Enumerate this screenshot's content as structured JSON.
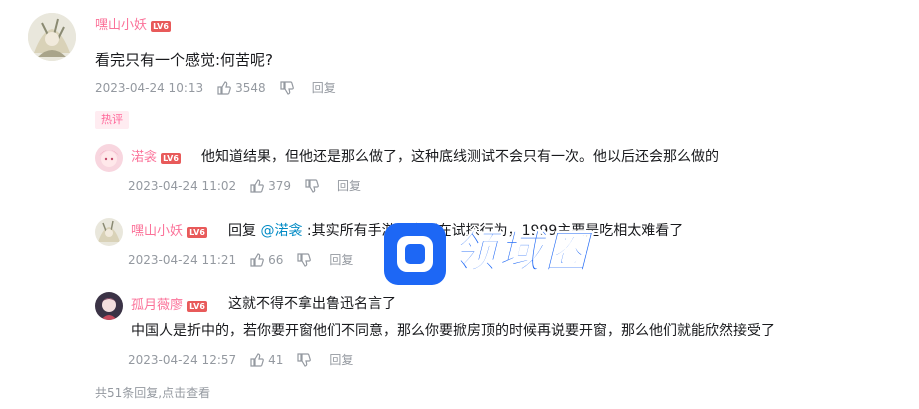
{
  "main_comment": {
    "username": "嘿山小妖",
    "level": "LV6",
    "text": "看完只有一个感觉:何苦呢?",
    "time": "2023-04-24 10:13",
    "likes": "3548",
    "reply_label": "回复",
    "badge": "热评"
  },
  "replies": [
    {
      "username": "渃衾",
      "level": "LV6",
      "text": "他知道结果，但他还是那么做了，这种底线测试不会只有一次。他以后还会那么做的",
      "time": "2023-04-24 11:02",
      "likes": "379",
      "reply_label": "回复"
    },
    {
      "username": "嘿山小妖",
      "level": "LV6",
      "prefix": "回复",
      "mention": "@渃衾",
      "text": ":其实所有手游厂商都在试探行为，1999主要是吃相太难看了",
      "time": "2023-04-24 11:21",
      "likes": "66",
      "reply_label": "回复"
    },
    {
      "username": "孤月薇廖",
      "level": "LV6",
      "text_line1": "这就不得不拿出鲁迅名言了",
      "text_line2": "中国人是折中的，若你要开窗他们不同意，那么你要掀房顶的时候再说要开窗，那么他们就能欣然接受了",
      "time": "2023-04-24 12:57",
      "likes": "41",
      "reply_label": "回复"
    }
  ],
  "footer": {
    "count_text": "共51条回复,",
    "view_text": "点击查看"
  },
  "watermark": {
    "text": "领域圈"
  },
  "colors": {
    "username": "#fb7299",
    "mention": "#008ac5",
    "meta": "#9499a0",
    "level_badge": "#e85a5a",
    "hot_badge_bg": "#ffecf1",
    "watermark": "#1d67f5"
  }
}
